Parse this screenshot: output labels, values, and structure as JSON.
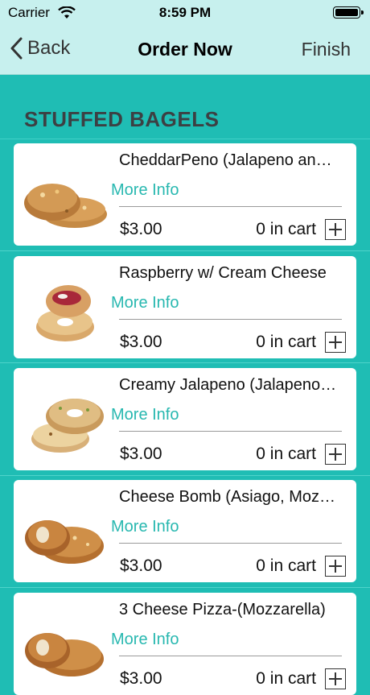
{
  "status_bar": {
    "carrier": "Carrier",
    "time": "8:59 PM"
  },
  "nav": {
    "back_label": "Back",
    "title": "Order Now",
    "finish_label": "Finish"
  },
  "section": {
    "title": "STUFFED BAGELS"
  },
  "items": [
    {
      "name": "CheddarPeno (Jalapeno and Cheddar)",
      "more": "More Info",
      "price": "$3.00",
      "cart": "0 in cart"
    },
    {
      "name": "Raspberry w/ Cream Cheese",
      "more": "More Info",
      "price": "$3.00",
      "cart": "0 in cart"
    },
    {
      "name": "Creamy Jalapeno (Jalapeno Cream Cheese)",
      "more": "More Info",
      "price": "$3.00",
      "cart": "0 in cart"
    },
    {
      "name": "Cheese Bomb (Asiago, Mozzarella)",
      "more": "More Info",
      "price": "$3.00",
      "cart": "0 in cart"
    },
    {
      "name": "3 Cheese Pizza-(Mozzarella)",
      "more": "More Info",
      "price": "$3.00",
      "cart": "0 in cart"
    }
  ],
  "colors": {
    "background": "#1fbdb4",
    "nav": "#c7f0ee",
    "accent": "#28b8b0"
  },
  "icons": {
    "back": "chevron-left-icon",
    "add": "plus-square-icon",
    "wifi": "wifi-icon",
    "battery": "battery-icon"
  }
}
